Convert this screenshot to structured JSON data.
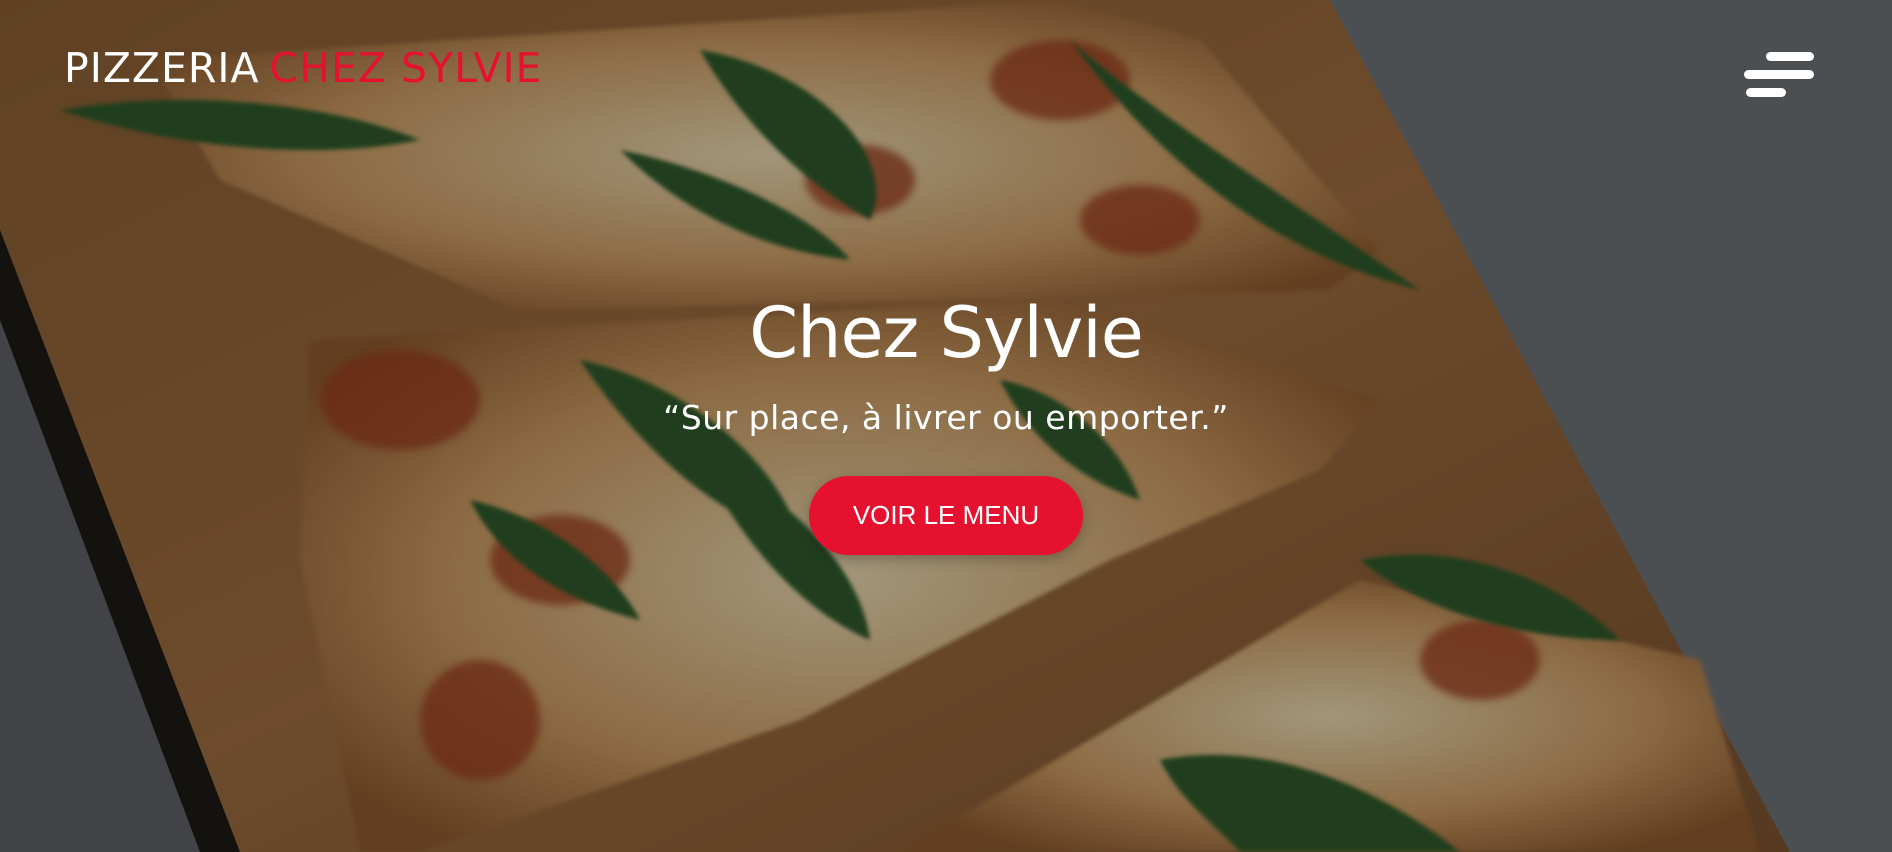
{
  "header": {
    "brand_part_1": "PIZZERIA",
    "brand_part_2": "CHEZ SYLVIE",
    "menu_icon": "hamburger-menu-icon"
  },
  "hero": {
    "title": "Chez Sylvie",
    "subtitle": "“Sur place, à livrer ou emporter.”",
    "cta_label": "VOIR LE MENU"
  },
  "colors": {
    "accent": "#e5112f",
    "text": "#ffffff",
    "background": "#3a3c3e"
  }
}
